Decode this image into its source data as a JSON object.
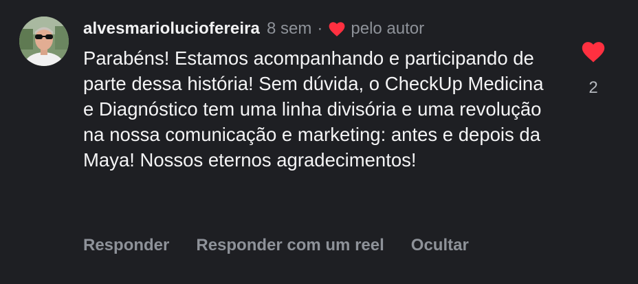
{
  "comment": {
    "username": "alvesmarioluciofereira",
    "time": "8 sem",
    "separator": "·",
    "author_label": "pelo autor",
    "text": "Parabéns! Estamos acompanhando e participando de parte dessa história! Sem dúvida, o CheckUp Medicina e Diagnóstico tem uma linha divisória e uma revolução na nossa comunicação e marketing: antes e depois da Maya! Nossos eternos agradecimentos!",
    "like_count": "2"
  },
  "actions": {
    "reply": "Responder",
    "reply_reel": "Responder com um reel",
    "hide": "Ocultar"
  },
  "icons": {
    "author_heart": "heart-icon",
    "like": "heart-icon"
  },
  "colors": {
    "background": "#1e1f23",
    "heart": "#ff3040",
    "muted": "#8e9299"
  }
}
